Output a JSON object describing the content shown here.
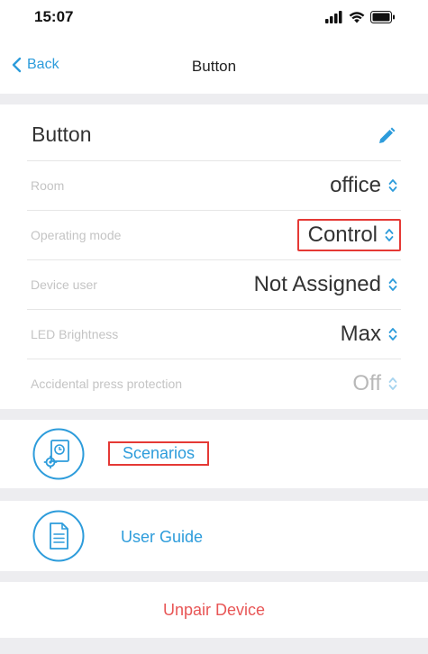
{
  "status_bar": {
    "time": "15:07"
  },
  "nav": {
    "back_label": "Back",
    "title": "Button"
  },
  "device": {
    "title": "Button",
    "settings": [
      {
        "label": "Room",
        "value": "office"
      },
      {
        "label": "Operating mode",
        "value": "Control"
      },
      {
        "label": "Device user",
        "value": "Not Assigned"
      },
      {
        "label": "LED Brightness",
        "value": "Max"
      },
      {
        "label": "Accidental press protection",
        "value": "Off"
      }
    ]
  },
  "links": {
    "scenarios": "Scenarios",
    "user_guide": "User Guide",
    "unpair": "Unpair Device"
  },
  "colors": {
    "accent": "#2d9cdb",
    "danger": "#e85656",
    "highlight": "#e53935"
  }
}
